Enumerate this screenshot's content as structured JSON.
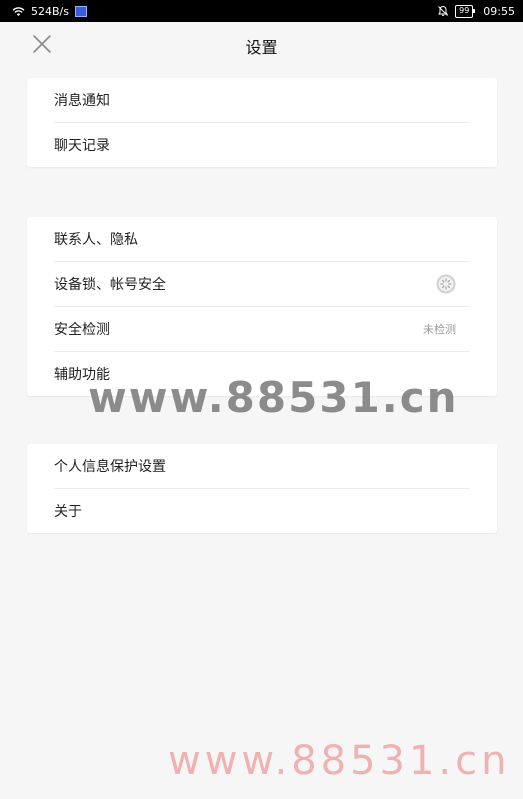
{
  "status_bar": {
    "speed": "524B/s",
    "battery": "99",
    "time": "09:55"
  },
  "header": {
    "title": "设置"
  },
  "groups": [
    {
      "items": [
        {
          "label": "消息通知"
        },
        {
          "label": "聊天记录"
        }
      ]
    },
    {
      "items": [
        {
          "label": "联系人、隐私"
        },
        {
          "label": "设备锁、帐号安全"
        },
        {
          "label": "安全检测",
          "status": "未检测"
        },
        {
          "label": "辅助功能"
        }
      ]
    },
    {
      "items": [
        {
          "label": "个人信息保护设置"
        },
        {
          "label": "关于"
        }
      ]
    }
  ],
  "watermarks": {
    "top": "www.88531.cn",
    "bottom": "www.88531.cn"
  },
  "icons": {
    "close": "close-icon",
    "loading": "loading-spinner-icon",
    "wifi": "wifi-icon",
    "bell": "bell-muted-icon"
  }
}
